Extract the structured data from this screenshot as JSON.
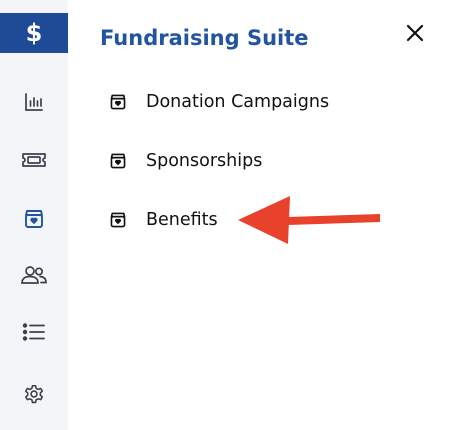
{
  "colors": {
    "accent": "#1e4a96",
    "title": "#23549e",
    "rail_background": "#f4f5f8",
    "annotation_arrow": "#e8412c"
  },
  "rail": {
    "items": [
      {
        "icon": "dollar-icon",
        "glyph": "$",
        "active": true
      },
      {
        "icon": "bar-chart-icon",
        "active": false
      },
      {
        "icon": "ticket-icon",
        "active": false
      },
      {
        "icon": "gift-box-icon",
        "active": false
      },
      {
        "icon": "users-icon",
        "active": false
      },
      {
        "icon": "list-icon",
        "active": false
      },
      {
        "icon": "gear-icon",
        "active": false
      }
    ]
  },
  "panel": {
    "title": "Fundraising Suite",
    "close_icon": "close-icon",
    "items": [
      {
        "label": "Donation Campaigns",
        "icon": "gift-box-icon"
      },
      {
        "label": "Sponsorships",
        "icon": "gift-box-icon"
      },
      {
        "label": "Benefits",
        "icon": "gift-box-icon"
      }
    ]
  },
  "annotation": {
    "icon": "red-arrow-icon",
    "points_to": "Benefits"
  }
}
